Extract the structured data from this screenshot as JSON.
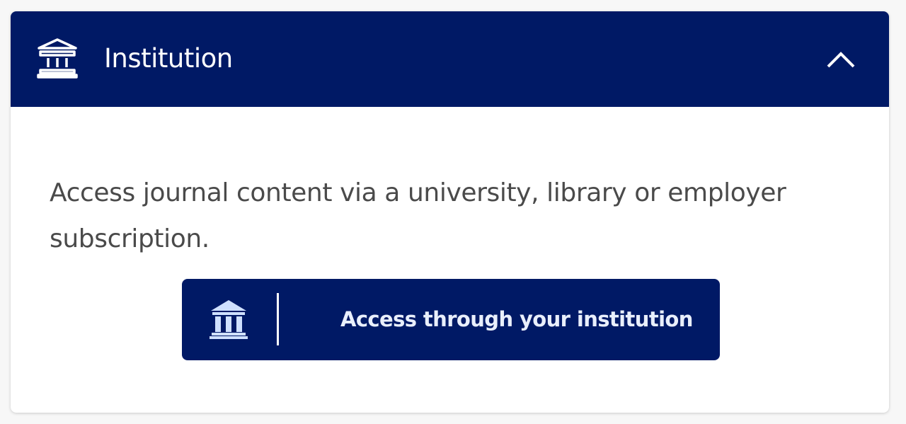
{
  "panel": {
    "title": "Institution",
    "icon": "institution-icon",
    "collapse_icon": "chevron-up-icon",
    "header_color": "#001965"
  },
  "body": {
    "description": "Access journal content via a university, library or employer subscription."
  },
  "access_button": {
    "label": "Access through your institution",
    "icon": "institution-icon",
    "background_color": "#001965"
  }
}
